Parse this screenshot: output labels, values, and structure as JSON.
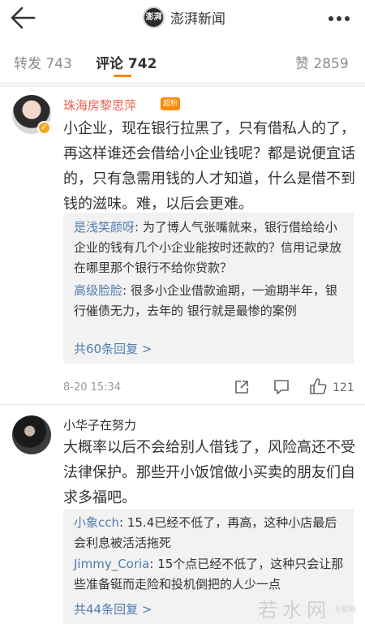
{
  "header": {
    "account_name": "澎湃新闻",
    "logo_text": "澎湃"
  },
  "tabs": {
    "repost": "转发 743",
    "comment": "评论 742",
    "like": "赞 2859"
  },
  "comments": [
    {
      "username": "珠海房黎思萍",
      "badge": "超粉",
      "text": "小企业，现在银行拉黑了，只有借私人的了，再这样谁还会借给小企业钱呢？都是说便宜话的，只有急需用钱的人才知道，什么是借不到钱的滋味。难，以后会更难。",
      "replies": [
        {
          "name": "是浅笑颜呀",
          "text": ": 为了博人气张嘴就来，银行借给给小企业的钱有几个小企业能按时还款的？信用记录放在哪里那个银行不给你贷款？"
        },
        {
          "name": "高级脸脸",
          "text": ": 很多小企业借款逾期，一逾期半年，银行催债无力，去年的      银行就是最惨的案例"
        }
      ],
      "more_replies": "共60条回复 >",
      "time": "8-20 15:34",
      "likes": "121"
    },
    {
      "username": "小华子在努力",
      "text": "大概率以后不会给别人借钱了，风险高还不受法律保护。那些开小饭馆做小买卖的朋友们自求多福吧。",
      "replies": [
        {
          "name": "小象cch",
          "text": ": 15.4已经不低了，再高，这种小店最后会利息被活活拖死"
        },
        {
          "name": "Jimmy_Coria",
          "text": ": 15个点已经不低了，这种只会让那些准备铤而走险和投机倒把的人少一点"
        }
      ],
      "more_replies": "共44条回复 >"
    }
  ],
  "watermark": {
    "main": "若水网",
    "sub": "互联网"
  },
  "colors": {
    "accent": "#ff8200",
    "link": "#507daf",
    "username_highlight": "#e8624c"
  }
}
